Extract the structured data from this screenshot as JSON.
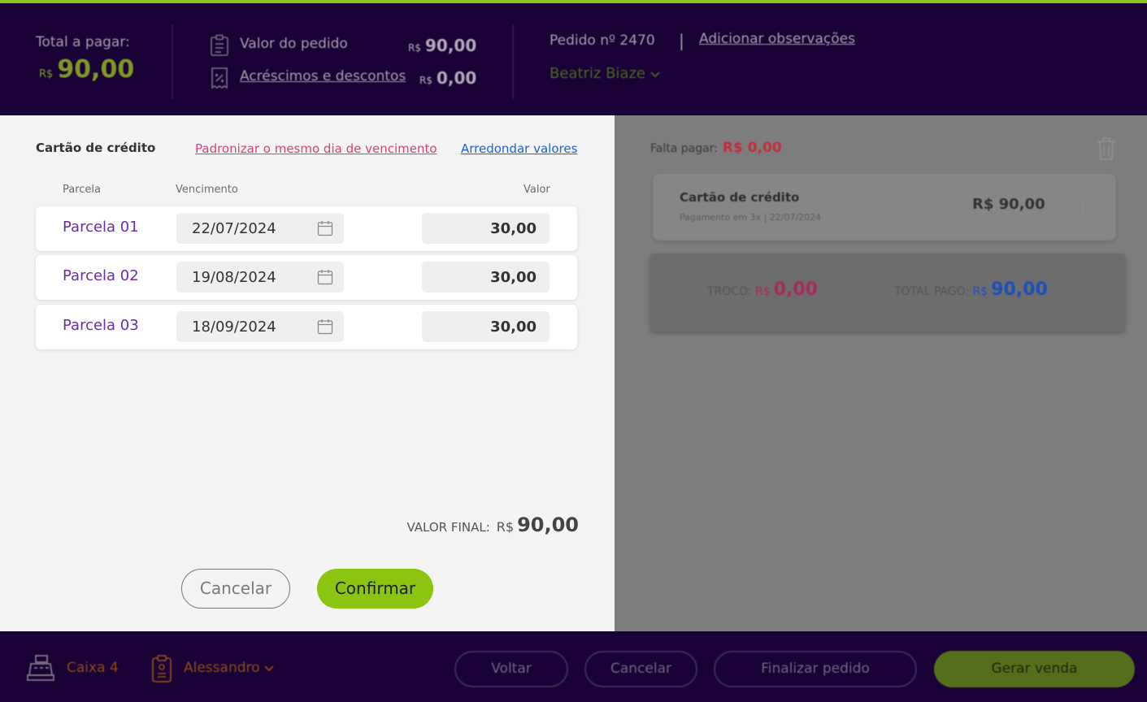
{
  "header": {
    "total_label": "Total a pagar:",
    "total_currency": "R$",
    "total_value": "90,00",
    "order_value_label": "Valor do pedido",
    "order_value_currency": "R$",
    "order_value": "90,00",
    "adjustments_label": "Acréscimos e descontos",
    "adjustments_currency": "R$",
    "adjustments_value": "0,00",
    "order_number": "Pedido nº 2470",
    "separator": "|",
    "add_notes": "Adicionar observações",
    "customer": "Beatriz Biaze"
  },
  "modal": {
    "title": "Cartão de crédito",
    "standardize_link": "Padronizar o mesmo dia de vencimento",
    "round_link": "Arredondar valores",
    "columns": {
      "installment": "Parcela",
      "due": "Vencimento",
      "value": "Valor"
    },
    "installments": [
      {
        "label": "Parcela 01",
        "due": "22/07/2024",
        "value": "30,00"
      },
      {
        "label": "Parcela 02",
        "due": "19/08/2024",
        "value": "30,00"
      },
      {
        "label": "Parcela 03",
        "due": "18/09/2024",
        "value": "30,00"
      }
    ],
    "final_label": "VALOR FINAL:",
    "final_currency": "R$",
    "final_value": "90,00",
    "cancel_label": "Cancelar",
    "confirm_label": "Confirmar"
  },
  "payment_panel": {
    "remaining_label": "Falta pagar:",
    "remaining_value": "R$ 0,00",
    "card": {
      "title": "Cartão de crédito",
      "subtitle": "Pagamento em 3x  |  22/07/2024",
      "amount": "R$ 90,00"
    },
    "change_label": "TROCO:",
    "change_currency": "R$",
    "change_value": "0,00",
    "total_paid_label": "TOTAL PAGO:",
    "total_paid_currency": "R$",
    "total_paid_value": "90,00"
  },
  "footer": {
    "register": "Caixa 4",
    "operator": "Alessandro",
    "back": "Voltar",
    "cancel": "Cancelar",
    "finish": "Finalizar pedido",
    "generate_sale": "Gerar venda"
  },
  "icons": {
    "clipboard": "clipboard-icon",
    "receipt_percent": "receipt-percent-icon",
    "chevron": "chevron-down-icon",
    "calendar": "calendar-icon",
    "trash": "trash-icon",
    "more": "more-vertical-icon",
    "cash_register": "cash-register-icon",
    "badge": "badge-icon"
  },
  "colors": {
    "header_bg": "#1b0236",
    "accent_green": "#8cc511",
    "installment_purple": "#6a2bb1",
    "link_pink": "#d3407e",
    "link_blue": "#1a62d6",
    "remaining_red": "#c42d3a",
    "total_paid_blue": "#1d4fb8"
  }
}
